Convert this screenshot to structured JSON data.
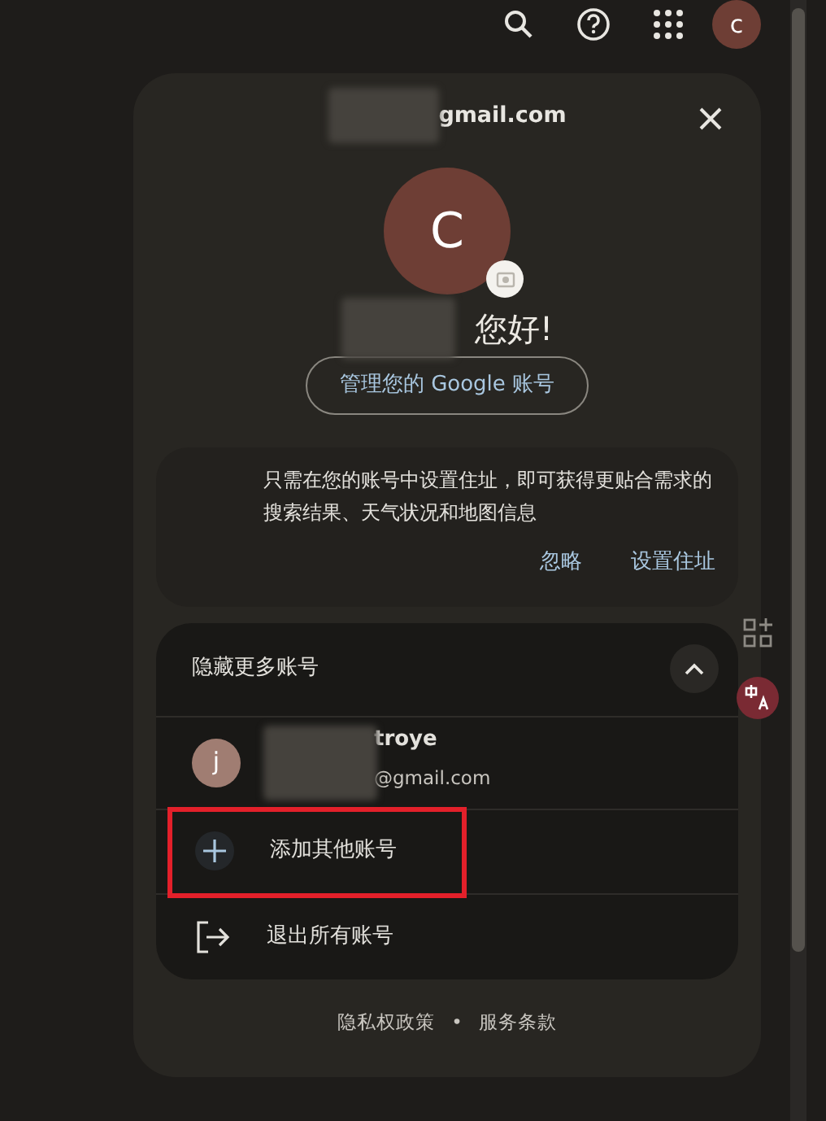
{
  "top_bar": {
    "avatar_initial": "c"
  },
  "panel": {
    "email": "gmail.com",
    "avatar_initial": "C",
    "greeting": "您好!",
    "manage_button": "管理您的 Google 账号",
    "address_prompt": {
      "text": "只需在您的账号中设置住址，即可获得更贴合需求的搜索结果、天气状况和地图信息",
      "actions": [
        "忽略",
        "设置住址"
      ]
    },
    "accounts": {
      "title": "隐藏更多账号",
      "expanded": true,
      "items": [
        {
          "initial": "j",
          "name": "troye",
          "email": "@gmail.com"
        }
      ],
      "actions": [
        {
          "kind": "add",
          "label": "添加其他账号",
          "highlighted": true
        },
        {
          "kind": "signout",
          "label": "退出所有账号",
          "highlighted": false
        }
      ]
    },
    "footer": {
      "links": [
        "隐私权政策",
        "服务条款"
      ],
      "separator": "•"
    }
  }
}
